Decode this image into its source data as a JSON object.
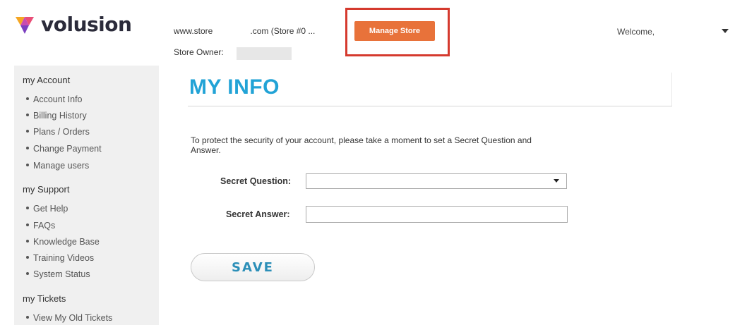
{
  "header": {
    "logo_text": "volusion",
    "store_url_prefix": "www.store",
    "store_url_suffix": ".com (Store #0 ...",
    "store_owner_label": "Store Owner:",
    "manage_store_label": "Manage Store",
    "welcome_text": "Welcome,"
  },
  "sidebar": {
    "sections": [
      {
        "heading": "my Account",
        "items": [
          "Account Info",
          "Billing History",
          "Plans / Orders",
          "Change Payment",
          "Manage users"
        ]
      },
      {
        "heading": "my Support",
        "items": [
          "Get Help",
          "FAQs",
          "Knowledge Base",
          "Training Videos",
          "System Status"
        ]
      },
      {
        "heading": "my Tickets",
        "items": [
          "View My Old Tickets"
        ]
      }
    ]
  },
  "main": {
    "title": "MY INFO",
    "intro": "To protect the security of your account, please take a moment to set a Secret Question and Answer.",
    "secret_question_label": "Secret Question:",
    "secret_question_value": "",
    "secret_answer_label": "Secret Answer:",
    "secret_answer_value": "",
    "save_label": "SAVE"
  },
  "colors": {
    "accent_blue": "#22a3d6",
    "manage_button": "#e8723a",
    "highlight_border": "#d53a2e"
  }
}
